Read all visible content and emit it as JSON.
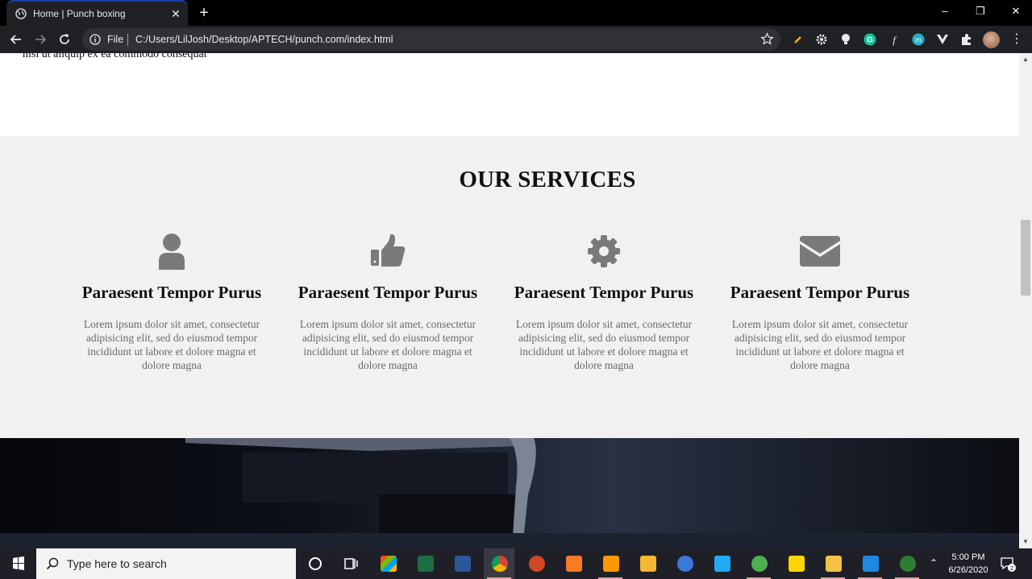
{
  "browser": {
    "tab_title": "Home | Punch boxing",
    "tab_close": "✕",
    "new_tab": "+",
    "address_scheme_label": "File",
    "address_url": "C:/Users/LilJosh/Desktop/APTECH/punch.com/index.html",
    "window_controls": {
      "minimize": "–",
      "restore": "❐",
      "close": "✕"
    }
  },
  "page": {
    "previous_section_text": "nisi ut aliquip ex ea commodo consequat",
    "services": {
      "title": "OUR SERVICES",
      "items": [
        {
          "icon": "user-icon",
          "heading": "Paraesent Tempor Purus",
          "text": "Lorem ipsum dolor sit amet, consectetur adipisicing elit, sed do eiusmod tempor incididunt ut labore et dolore magna et dolore magna"
        },
        {
          "icon": "thumbs-up-icon",
          "heading": "Paraesent Tempor Purus",
          "text": "Lorem ipsum dolor sit amet, consectetur adipisicing elit, sed do eiusmod tempor incididunt ut labore et dolore magna et dolore magna"
        },
        {
          "icon": "gear-icon",
          "heading": "Paraesent Tempor Purus",
          "text": "Lorem ipsum dolor sit amet, consectetur adipisicing elit, sed do eiusmod tempor incididunt ut labore et dolore magna et dolore magna"
        },
        {
          "icon": "envelope-icon",
          "heading": "Paraesent Tempor Purus",
          "text": "Lorem ipsum dolor sit amet, consectetur adipisicing elit, sed do eiusmod tempor incididunt ut labore et dolore magna et dolore magna"
        }
      ]
    }
  },
  "taskbar": {
    "search_placeholder": "Type here to search",
    "time": "5:00 PM",
    "date": "6/26/2020",
    "notification_count": "2",
    "apps": [
      "task-view",
      "microsoft-store",
      "excel",
      "word",
      "chrome",
      "powerpoint",
      "xampp",
      "sublime-text",
      "paint",
      "cortana-app",
      "visual-studio-code",
      "network-app",
      "gallery",
      "file-explorer",
      "photos",
      "app-green"
    ]
  },
  "colors": {
    "service_icon": "#7a7a7a",
    "services_bg": "#f1f1f1",
    "chrome_dark": "#202124"
  }
}
